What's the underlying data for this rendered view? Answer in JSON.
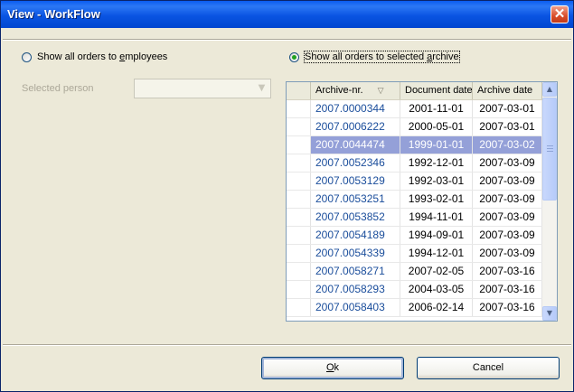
{
  "window": {
    "title": "View - WorkFlow",
    "close_glyph": "✕"
  },
  "options": {
    "employees": {
      "pre": "Show all orders to ",
      "accel": "e",
      "post": "mployees",
      "checked": false
    },
    "archive": {
      "pre": "Show all orders to selected ",
      "accel": "a",
      "post": "rchive",
      "checked": true
    }
  },
  "selected_person": {
    "label": "Selected person",
    "value": ""
  },
  "table": {
    "columns": [
      "",
      "Archive-nr.",
      "Document date",
      "Archive date"
    ],
    "sort_indicator": "▽",
    "rows": [
      [
        "2007.0000344",
        "2001-11-01",
        "2007-03-01"
      ],
      [
        "2007.0006222",
        "2000-05-01",
        "2007-03-01"
      ],
      [
        "2007.0044474",
        "1999-01-01",
        "2007-03-02"
      ],
      [
        "2007.0052346",
        "1992-12-01",
        "2007-03-09"
      ],
      [
        "2007.0053129",
        "1992-03-01",
        "2007-03-09"
      ],
      [
        "2007.0053251",
        "1993-02-01",
        "2007-03-09"
      ],
      [
        "2007.0053852",
        "1994-11-01",
        "2007-03-09"
      ],
      [
        "2007.0054189",
        "1994-09-01",
        "2007-03-09"
      ],
      [
        "2007.0054339",
        "1994-12-01",
        "2007-03-09"
      ],
      [
        "2007.0058271",
        "2007-02-05",
        "2007-03-16"
      ],
      [
        "2007.0058293",
        "2004-03-05",
        "2007-03-16"
      ],
      [
        "2007.0058403",
        "2006-02-14",
        "2007-03-16"
      ]
    ],
    "selected_row": 2
  },
  "buttons": {
    "ok": {
      "accel": "O",
      "post": "k"
    },
    "cancel": {
      "label": "Cancel"
    }
  },
  "icons": {
    "scroll_up": "scroll-up-icon",
    "scroll_down": "scroll-down-icon",
    "dropdown": "chevron-down-icon"
  }
}
